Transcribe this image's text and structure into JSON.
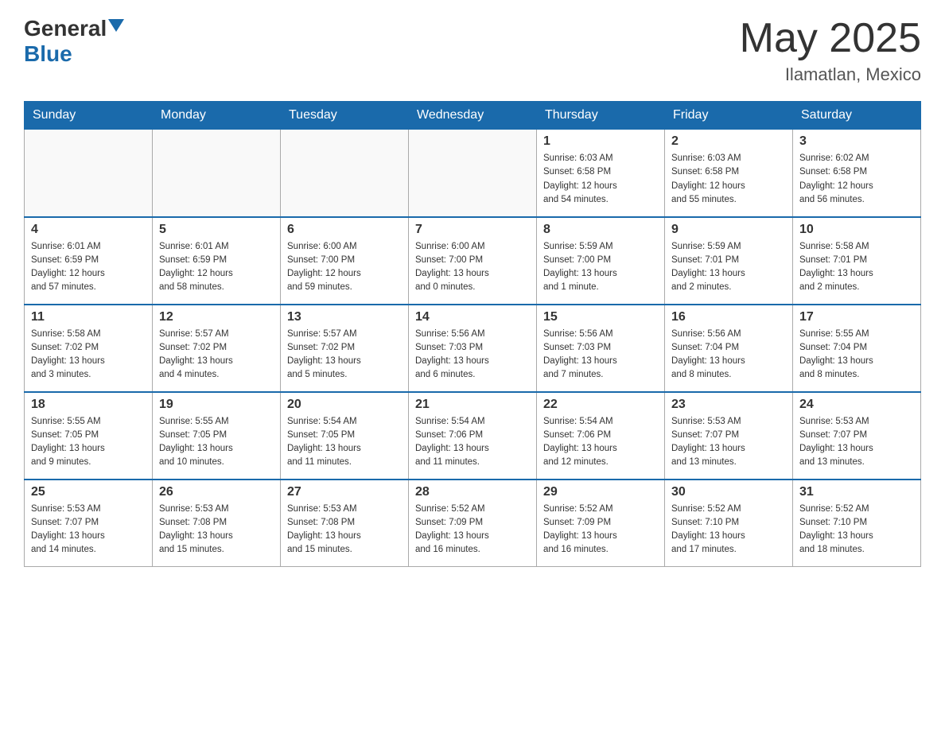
{
  "header": {
    "logo_general": "General",
    "logo_blue": "Blue",
    "month_year": "May 2025",
    "location": "Ilamatlan, Mexico"
  },
  "weekdays": [
    "Sunday",
    "Monday",
    "Tuesday",
    "Wednesday",
    "Thursday",
    "Friday",
    "Saturday"
  ],
  "weeks": [
    [
      {
        "day": "",
        "info": ""
      },
      {
        "day": "",
        "info": ""
      },
      {
        "day": "",
        "info": ""
      },
      {
        "day": "",
        "info": ""
      },
      {
        "day": "1",
        "info": "Sunrise: 6:03 AM\nSunset: 6:58 PM\nDaylight: 12 hours\nand 54 minutes."
      },
      {
        "day": "2",
        "info": "Sunrise: 6:03 AM\nSunset: 6:58 PM\nDaylight: 12 hours\nand 55 minutes."
      },
      {
        "day": "3",
        "info": "Sunrise: 6:02 AM\nSunset: 6:58 PM\nDaylight: 12 hours\nand 56 minutes."
      }
    ],
    [
      {
        "day": "4",
        "info": "Sunrise: 6:01 AM\nSunset: 6:59 PM\nDaylight: 12 hours\nand 57 minutes."
      },
      {
        "day": "5",
        "info": "Sunrise: 6:01 AM\nSunset: 6:59 PM\nDaylight: 12 hours\nand 58 minutes."
      },
      {
        "day": "6",
        "info": "Sunrise: 6:00 AM\nSunset: 7:00 PM\nDaylight: 12 hours\nand 59 minutes."
      },
      {
        "day": "7",
        "info": "Sunrise: 6:00 AM\nSunset: 7:00 PM\nDaylight: 13 hours\nand 0 minutes."
      },
      {
        "day": "8",
        "info": "Sunrise: 5:59 AM\nSunset: 7:00 PM\nDaylight: 13 hours\nand 1 minute."
      },
      {
        "day": "9",
        "info": "Sunrise: 5:59 AM\nSunset: 7:01 PM\nDaylight: 13 hours\nand 2 minutes."
      },
      {
        "day": "10",
        "info": "Sunrise: 5:58 AM\nSunset: 7:01 PM\nDaylight: 13 hours\nand 2 minutes."
      }
    ],
    [
      {
        "day": "11",
        "info": "Sunrise: 5:58 AM\nSunset: 7:02 PM\nDaylight: 13 hours\nand 3 minutes."
      },
      {
        "day": "12",
        "info": "Sunrise: 5:57 AM\nSunset: 7:02 PM\nDaylight: 13 hours\nand 4 minutes."
      },
      {
        "day": "13",
        "info": "Sunrise: 5:57 AM\nSunset: 7:02 PM\nDaylight: 13 hours\nand 5 minutes."
      },
      {
        "day": "14",
        "info": "Sunrise: 5:56 AM\nSunset: 7:03 PM\nDaylight: 13 hours\nand 6 minutes."
      },
      {
        "day": "15",
        "info": "Sunrise: 5:56 AM\nSunset: 7:03 PM\nDaylight: 13 hours\nand 7 minutes."
      },
      {
        "day": "16",
        "info": "Sunrise: 5:56 AM\nSunset: 7:04 PM\nDaylight: 13 hours\nand 8 minutes."
      },
      {
        "day": "17",
        "info": "Sunrise: 5:55 AM\nSunset: 7:04 PM\nDaylight: 13 hours\nand 8 minutes."
      }
    ],
    [
      {
        "day": "18",
        "info": "Sunrise: 5:55 AM\nSunset: 7:05 PM\nDaylight: 13 hours\nand 9 minutes."
      },
      {
        "day": "19",
        "info": "Sunrise: 5:55 AM\nSunset: 7:05 PM\nDaylight: 13 hours\nand 10 minutes."
      },
      {
        "day": "20",
        "info": "Sunrise: 5:54 AM\nSunset: 7:05 PM\nDaylight: 13 hours\nand 11 minutes."
      },
      {
        "day": "21",
        "info": "Sunrise: 5:54 AM\nSunset: 7:06 PM\nDaylight: 13 hours\nand 11 minutes."
      },
      {
        "day": "22",
        "info": "Sunrise: 5:54 AM\nSunset: 7:06 PM\nDaylight: 13 hours\nand 12 minutes."
      },
      {
        "day": "23",
        "info": "Sunrise: 5:53 AM\nSunset: 7:07 PM\nDaylight: 13 hours\nand 13 minutes."
      },
      {
        "day": "24",
        "info": "Sunrise: 5:53 AM\nSunset: 7:07 PM\nDaylight: 13 hours\nand 13 minutes."
      }
    ],
    [
      {
        "day": "25",
        "info": "Sunrise: 5:53 AM\nSunset: 7:07 PM\nDaylight: 13 hours\nand 14 minutes."
      },
      {
        "day": "26",
        "info": "Sunrise: 5:53 AM\nSunset: 7:08 PM\nDaylight: 13 hours\nand 15 minutes."
      },
      {
        "day": "27",
        "info": "Sunrise: 5:53 AM\nSunset: 7:08 PM\nDaylight: 13 hours\nand 15 minutes."
      },
      {
        "day": "28",
        "info": "Sunrise: 5:52 AM\nSunset: 7:09 PM\nDaylight: 13 hours\nand 16 minutes."
      },
      {
        "day": "29",
        "info": "Sunrise: 5:52 AM\nSunset: 7:09 PM\nDaylight: 13 hours\nand 16 minutes."
      },
      {
        "day": "30",
        "info": "Sunrise: 5:52 AM\nSunset: 7:10 PM\nDaylight: 13 hours\nand 17 minutes."
      },
      {
        "day": "31",
        "info": "Sunrise: 5:52 AM\nSunset: 7:10 PM\nDaylight: 13 hours\nand 18 minutes."
      }
    ]
  ]
}
